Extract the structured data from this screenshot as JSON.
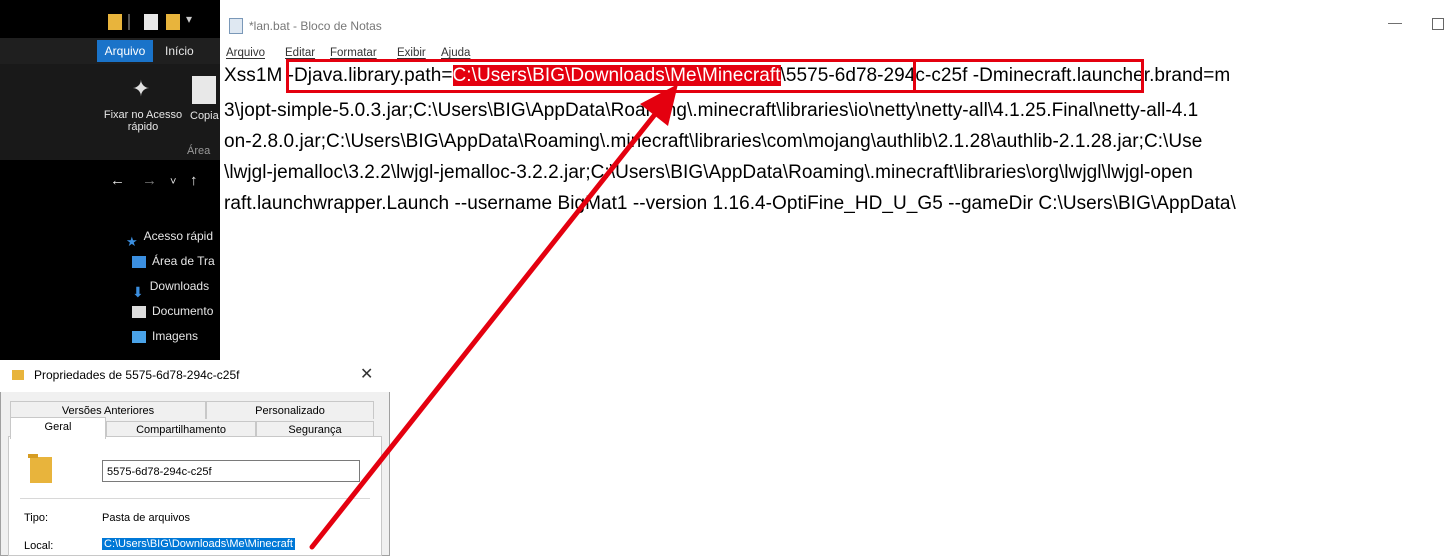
{
  "explorer": {
    "tabs": [
      "Arquivo",
      "Início"
    ],
    "pin_label": "Fixar no Acesso rápido",
    "copy_label": "Copia",
    "group_label": "Área",
    "tree": [
      "Acesso rápid",
      "Área de Tra",
      "Downloads",
      "Documento",
      "Imagens"
    ]
  },
  "notepad": {
    "title": "*lan.bat - Bloco de Notas",
    "menu": [
      "Arquivo",
      "Editar",
      "Formatar",
      "Exibir",
      "Ajuda"
    ],
    "line1": {
      "pre": "Xss1M ",
      "boxed_text": "-Djava.library.path=",
      "highlight": "C:\\Users\\BIG\\Downloads\\Me\\Minecraft",
      "boxed_folder": "\\5575-6d78-294c-c25f",
      "post": " -Dminecraft.launcher.brand=m"
    },
    "lines": [
      "3\\jopt-simple-5.0.3.jar;C:\\Users\\BIG\\AppData\\Roaming\\.minecraft\\libraries\\io\\netty\\netty-all\\4.1.25.Final\\netty-all-4.1",
      "on-2.8.0.jar;C:\\Users\\BIG\\AppData\\Roaming\\.minecraft\\libraries\\com\\mojang\\authlib\\2.1.28\\authlib-2.1.28.jar;C:\\Use",
      "\\lwjgl-jemalloc\\3.2.2\\lwjgl-jemalloc-3.2.2.jar;C:\\Users\\BIG\\AppData\\Roaming\\.minecraft\\libraries\\org\\lwjgl\\lwjgl-open",
      "raft.launchwrapper.Launch --username BigMat1 --version 1.16.4-OptiFine_HD_U_G5 --gameDir C:\\Users\\BIG\\AppData\\"
    ]
  },
  "properties": {
    "title": "Propriedades de 5575-6d78-294c-c25f",
    "tabs_row1": [
      "Versões Anteriores",
      "Personalizado"
    ],
    "tabs_row2": [
      "Geral",
      "Compartilhamento",
      "Segurança"
    ],
    "name": "5575-6d78-294c-c25f",
    "tipo_label": "Tipo:",
    "tipo_value": "Pasta de arquivos",
    "local_label": "Local:",
    "local_value": "C:\\Users\\BIG\\Downloads\\Me\\Minecraft"
  },
  "colors": {
    "annotation_red": "#e4000f",
    "selection_blue": "#0078d7",
    "explorer_accent": "#1a73c9"
  }
}
